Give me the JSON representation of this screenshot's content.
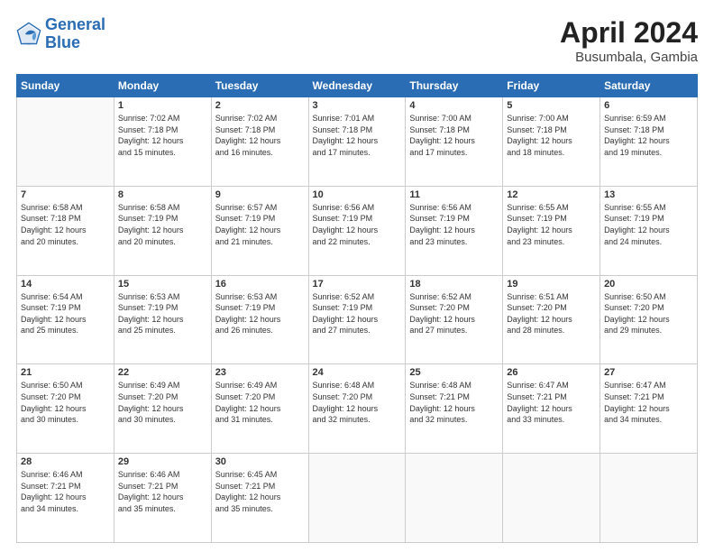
{
  "header": {
    "logo_line1": "General",
    "logo_line2": "Blue",
    "title": "April 2024",
    "subtitle": "Busumbala, Gambia"
  },
  "weekdays": [
    "Sunday",
    "Monday",
    "Tuesday",
    "Wednesday",
    "Thursday",
    "Friday",
    "Saturday"
  ],
  "weeks": [
    [
      {
        "day": "",
        "info": ""
      },
      {
        "day": "1",
        "info": "Sunrise: 7:02 AM\nSunset: 7:18 PM\nDaylight: 12 hours\nand 15 minutes."
      },
      {
        "day": "2",
        "info": "Sunrise: 7:02 AM\nSunset: 7:18 PM\nDaylight: 12 hours\nand 16 minutes."
      },
      {
        "day": "3",
        "info": "Sunrise: 7:01 AM\nSunset: 7:18 PM\nDaylight: 12 hours\nand 17 minutes."
      },
      {
        "day": "4",
        "info": "Sunrise: 7:00 AM\nSunset: 7:18 PM\nDaylight: 12 hours\nand 17 minutes."
      },
      {
        "day": "5",
        "info": "Sunrise: 7:00 AM\nSunset: 7:18 PM\nDaylight: 12 hours\nand 18 minutes."
      },
      {
        "day": "6",
        "info": "Sunrise: 6:59 AM\nSunset: 7:18 PM\nDaylight: 12 hours\nand 19 minutes."
      }
    ],
    [
      {
        "day": "7",
        "info": "Sunrise: 6:58 AM\nSunset: 7:18 PM\nDaylight: 12 hours\nand 20 minutes."
      },
      {
        "day": "8",
        "info": "Sunrise: 6:58 AM\nSunset: 7:19 PM\nDaylight: 12 hours\nand 20 minutes."
      },
      {
        "day": "9",
        "info": "Sunrise: 6:57 AM\nSunset: 7:19 PM\nDaylight: 12 hours\nand 21 minutes."
      },
      {
        "day": "10",
        "info": "Sunrise: 6:56 AM\nSunset: 7:19 PM\nDaylight: 12 hours\nand 22 minutes."
      },
      {
        "day": "11",
        "info": "Sunrise: 6:56 AM\nSunset: 7:19 PM\nDaylight: 12 hours\nand 23 minutes."
      },
      {
        "day": "12",
        "info": "Sunrise: 6:55 AM\nSunset: 7:19 PM\nDaylight: 12 hours\nand 23 minutes."
      },
      {
        "day": "13",
        "info": "Sunrise: 6:55 AM\nSunset: 7:19 PM\nDaylight: 12 hours\nand 24 minutes."
      }
    ],
    [
      {
        "day": "14",
        "info": "Sunrise: 6:54 AM\nSunset: 7:19 PM\nDaylight: 12 hours\nand 25 minutes."
      },
      {
        "day": "15",
        "info": "Sunrise: 6:53 AM\nSunset: 7:19 PM\nDaylight: 12 hours\nand 25 minutes."
      },
      {
        "day": "16",
        "info": "Sunrise: 6:53 AM\nSunset: 7:19 PM\nDaylight: 12 hours\nand 26 minutes."
      },
      {
        "day": "17",
        "info": "Sunrise: 6:52 AM\nSunset: 7:19 PM\nDaylight: 12 hours\nand 27 minutes."
      },
      {
        "day": "18",
        "info": "Sunrise: 6:52 AM\nSunset: 7:20 PM\nDaylight: 12 hours\nand 27 minutes."
      },
      {
        "day": "19",
        "info": "Sunrise: 6:51 AM\nSunset: 7:20 PM\nDaylight: 12 hours\nand 28 minutes."
      },
      {
        "day": "20",
        "info": "Sunrise: 6:50 AM\nSunset: 7:20 PM\nDaylight: 12 hours\nand 29 minutes."
      }
    ],
    [
      {
        "day": "21",
        "info": "Sunrise: 6:50 AM\nSunset: 7:20 PM\nDaylight: 12 hours\nand 30 minutes."
      },
      {
        "day": "22",
        "info": "Sunrise: 6:49 AM\nSunset: 7:20 PM\nDaylight: 12 hours\nand 30 minutes."
      },
      {
        "day": "23",
        "info": "Sunrise: 6:49 AM\nSunset: 7:20 PM\nDaylight: 12 hours\nand 31 minutes."
      },
      {
        "day": "24",
        "info": "Sunrise: 6:48 AM\nSunset: 7:20 PM\nDaylight: 12 hours\nand 32 minutes."
      },
      {
        "day": "25",
        "info": "Sunrise: 6:48 AM\nSunset: 7:21 PM\nDaylight: 12 hours\nand 32 minutes."
      },
      {
        "day": "26",
        "info": "Sunrise: 6:47 AM\nSunset: 7:21 PM\nDaylight: 12 hours\nand 33 minutes."
      },
      {
        "day": "27",
        "info": "Sunrise: 6:47 AM\nSunset: 7:21 PM\nDaylight: 12 hours\nand 34 minutes."
      }
    ],
    [
      {
        "day": "28",
        "info": "Sunrise: 6:46 AM\nSunset: 7:21 PM\nDaylight: 12 hours\nand 34 minutes."
      },
      {
        "day": "29",
        "info": "Sunrise: 6:46 AM\nSunset: 7:21 PM\nDaylight: 12 hours\nand 35 minutes."
      },
      {
        "day": "30",
        "info": "Sunrise: 6:45 AM\nSunset: 7:21 PM\nDaylight: 12 hours\nand 35 minutes."
      },
      {
        "day": "",
        "info": ""
      },
      {
        "day": "",
        "info": ""
      },
      {
        "day": "",
        "info": ""
      },
      {
        "day": "",
        "info": ""
      }
    ]
  ]
}
